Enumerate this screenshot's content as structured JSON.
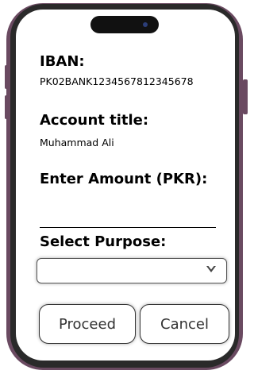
{
  "form": {
    "iban_label": "IBAN:",
    "iban_value": "PK02BANK1234567812345678",
    "account_title_label": "Account title:",
    "account_title_value": "Muhammad Ali",
    "amount_label": "Enter Amount (PKR):",
    "amount_value": "",
    "purpose_label": "Select Purpose:",
    "purpose_selected": ""
  },
  "buttons": {
    "proceed": "Proceed",
    "cancel": "Cancel"
  },
  "icons": {
    "dropdown": "chevron-down-icon"
  },
  "colors": {
    "frame": "#6a4a61"
  }
}
